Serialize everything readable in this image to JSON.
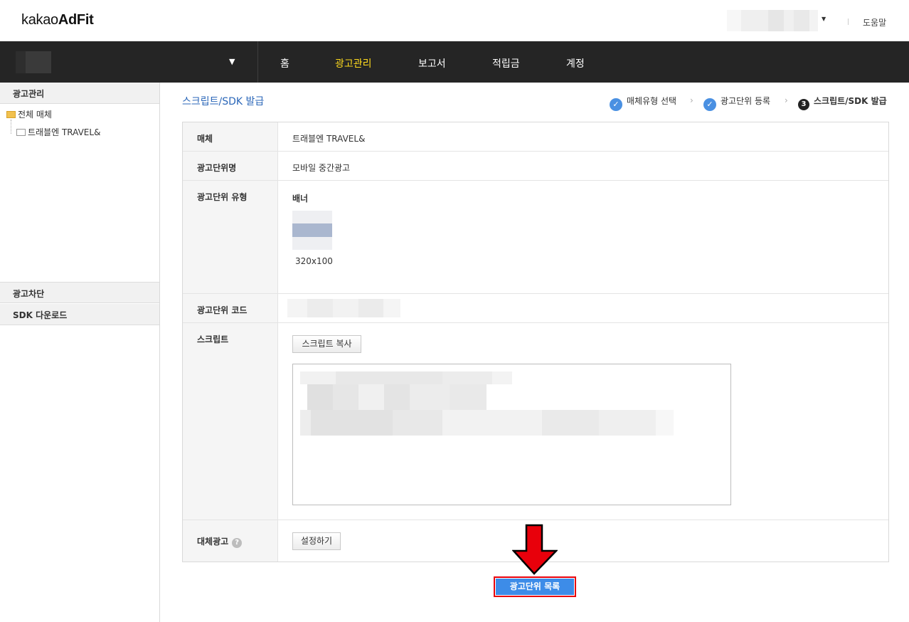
{
  "header": {
    "logo_prefix": "kakao",
    "logo_bold": "AdFit",
    "help_label": "도움말"
  },
  "nav": {
    "items": [
      {
        "label": "홈",
        "active": false
      },
      {
        "label": "광고관리",
        "active": true
      },
      {
        "label": "보고서",
        "active": false
      },
      {
        "label": "적립금",
        "active": false
      },
      {
        "label": "계정",
        "active": false
      }
    ]
  },
  "sidebar": {
    "sections": [
      "광고관리",
      "광고차단",
      "SDK 다운로드"
    ],
    "tree": {
      "root_label": "전체 매체",
      "child_label": "트래블엔 TRAVEL&"
    }
  },
  "page": {
    "title": "스크립트/SDK 발급",
    "steps": [
      {
        "label": "매체유형 선택",
        "state": "done"
      },
      {
        "label": "광고단위 등록",
        "state": "done"
      },
      {
        "number": "3",
        "label": "스크립트/SDK 발급",
        "state": "current"
      }
    ]
  },
  "form": {
    "media_label": "매체",
    "media_value": "트래블엔 TRAVEL&",
    "unit_name_label": "광고단위명",
    "unit_name_value": "모바일 중간광고",
    "unit_type_label": "광고단위 유형",
    "unit_type_value": "배너",
    "unit_size": "320x100",
    "unit_code_label": "광고단위 코드",
    "script_label": "스크립트",
    "copy_script_button": "스크립트 복사",
    "fallback_label": "대체광고",
    "fallback_help_icon": "?",
    "fallback_button": "설정하기"
  },
  "footer": {
    "list_button": "광고단위 목록"
  },
  "colors": {
    "nav_bg": "#252525",
    "nav_active": "#ffdb1d",
    "title_blue": "#2a66b8",
    "step_check": "#4a90e2",
    "primary_button": "#3d8ce8",
    "highlight_red": "#e8000b"
  }
}
